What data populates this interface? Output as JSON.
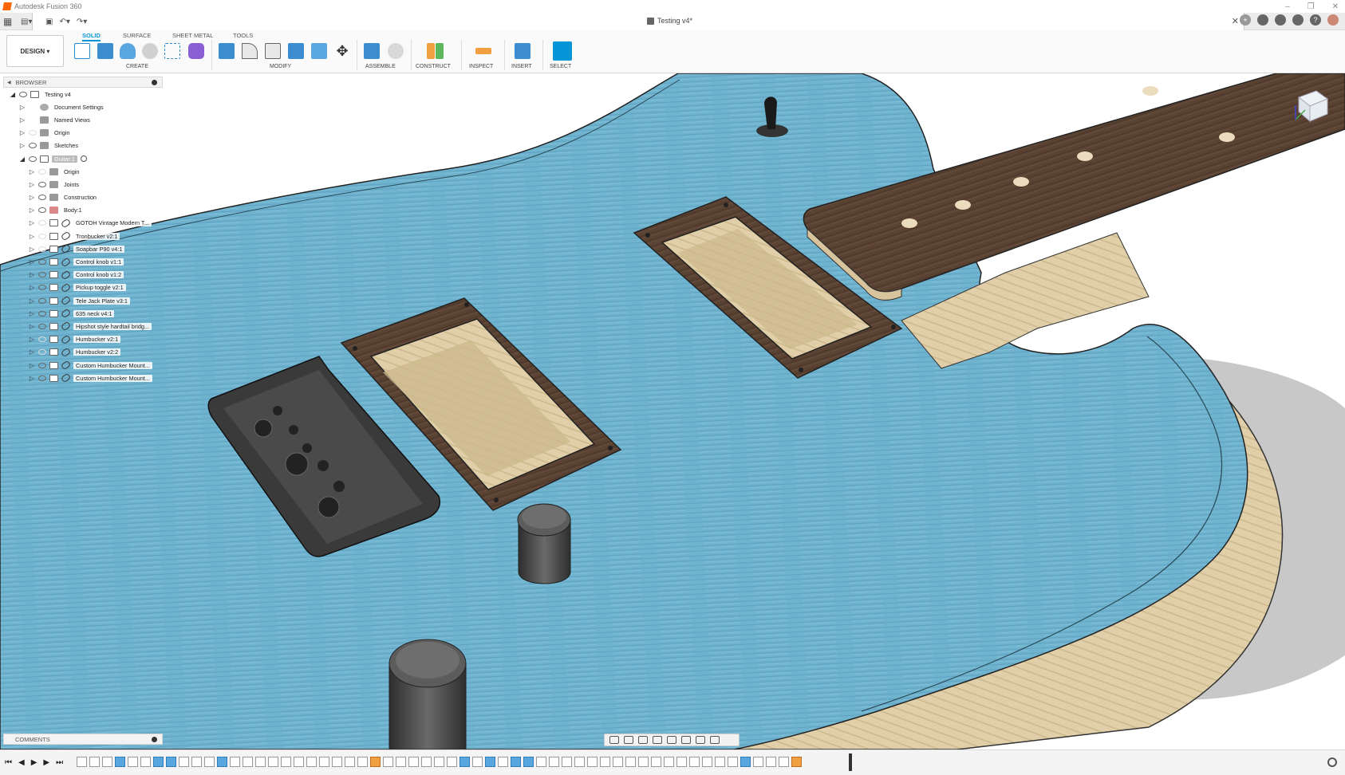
{
  "window": {
    "title": "Autodesk Fusion 360"
  },
  "document": {
    "tab_title": "Testing v4*"
  },
  "toolbar": {
    "workspace": "DESIGN",
    "tabs": [
      {
        "label": "SOLID",
        "active": true
      },
      {
        "label": "SURFACE",
        "active": false
      },
      {
        "label": "SHEET METAL",
        "active": false
      },
      {
        "label": "TOOLS",
        "active": false
      }
    ],
    "groups": [
      "CREATE",
      "MODIFY",
      "ASSEMBLE",
      "CONSTRUCT",
      "INSPECT",
      "INSERT",
      "SELECT"
    ]
  },
  "browser": {
    "title": "BROWSER",
    "items": [
      {
        "label": "Testing v4",
        "icon": "file-icon"
      },
      {
        "label": "Document Settings",
        "icon": "gear-icon"
      },
      {
        "label": "Named Views",
        "icon": "folder-icon"
      },
      {
        "label": "Origin",
        "icon": "folder-icon"
      },
      {
        "label": "Sketches",
        "icon": "folder-icon"
      },
      {
        "label": "Guitar:1",
        "icon": "component-icon"
      },
      {
        "label": "Origin",
        "icon": "folder-icon"
      },
      {
        "label": "Joints",
        "icon": "folder-icon"
      },
      {
        "label": "Construction",
        "icon": "folder-icon"
      },
      {
        "label": "Body:1",
        "icon": "body-icon"
      },
      {
        "label": "GOTOH Vintage Modern T...",
        "icon": "link-icon"
      },
      {
        "label": "Tronbucker v2:1",
        "icon": "link-icon"
      },
      {
        "label": "Soapbar P90 v4:1",
        "icon": "link-icon"
      },
      {
        "label": "Control knob v1:1",
        "icon": "link-icon"
      },
      {
        "label": "Control knob v1:2",
        "icon": "link-icon"
      },
      {
        "label": "Pickup toggle v2:1",
        "icon": "link-icon"
      },
      {
        "label": "Tele Jack Plate v3:1",
        "icon": "link-icon"
      },
      {
        "label": "635 neck v4:1",
        "icon": "link-icon"
      },
      {
        "label": "Hipshot style hardtail bridg...",
        "icon": "link-icon"
      },
      {
        "label": "Humbucker v2:1",
        "icon": "link-icon"
      },
      {
        "label": "Humbucker v2:2",
        "icon": "link-icon"
      },
      {
        "label": "Custom Humbucker Mount...",
        "icon": "link-icon"
      },
      {
        "label": "Custom Humbucker Mount...",
        "icon": "link-icon"
      }
    ]
  },
  "comments": {
    "title": "COMMENTS"
  },
  "colors": {
    "accent": "#0696d7",
    "guitar_body": "#6fb3cf",
    "fretboard": "#5a4232",
    "wood_side": "#d9c5a0",
    "hardware": "#3a3a3a"
  }
}
